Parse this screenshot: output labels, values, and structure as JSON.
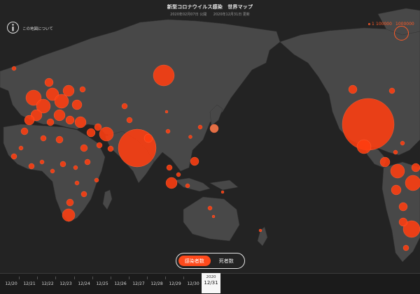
{
  "header": {
    "title": "新型コロナウイルス感染　世界マップ",
    "published": "2020年02月07日 公開",
    "updated": "2020年12月31日 更新"
  },
  "info": {
    "label": "この地図について",
    "icon": "info-icon"
  },
  "legend": {
    "small_value": "1",
    "mid_value": "100000",
    "large_value": "1000000"
  },
  "toggle": {
    "cases_label": "感染者数",
    "deaths_label": "死者数",
    "active": "cases"
  },
  "timeline": {
    "dates": [
      "12/20",
      "12/21",
      "12/22",
      "12/23",
      "12/24",
      "12/25",
      "12/26",
      "12/27",
      "12/28",
      "12/29",
      "12/30"
    ],
    "selected_year": "2020",
    "selected_date": "12/31"
  },
  "colors": {
    "background": "#232323",
    "land": "#4a4a4a",
    "bubble": "#ff3d10",
    "accent": "#ff4a1c"
  }
}
